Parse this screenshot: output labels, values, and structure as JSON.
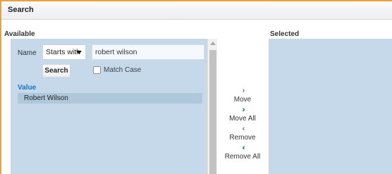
{
  "dialog": {
    "title": "Search"
  },
  "available": {
    "label": "Available",
    "name_label": "Name",
    "operator": "Starts with",
    "search_value": "robert wilson",
    "search_button": "Search",
    "match_case_label": "Match Case",
    "match_case_checked": false,
    "results_header": "Value",
    "results": [
      "Robert Wilson"
    ]
  },
  "actions": {
    "move": {
      "label": "Move",
      "icon": "chevron-right-icon"
    },
    "move_all": {
      "label": "Move All",
      "icon": "double-chevron-right-icon"
    },
    "remove": {
      "label": "Remove",
      "icon": "chevron-left-icon"
    },
    "remove_all": {
      "label": "Remove All",
      "icon": "double-chevron-left-icon"
    }
  },
  "selected": {
    "label": "Selected",
    "items": []
  },
  "colors": {
    "accent": "#2c7ccf",
    "panel": "#c5d9ea",
    "border_highlight": "#e8a33c",
    "value_header": "#1a73c8"
  }
}
